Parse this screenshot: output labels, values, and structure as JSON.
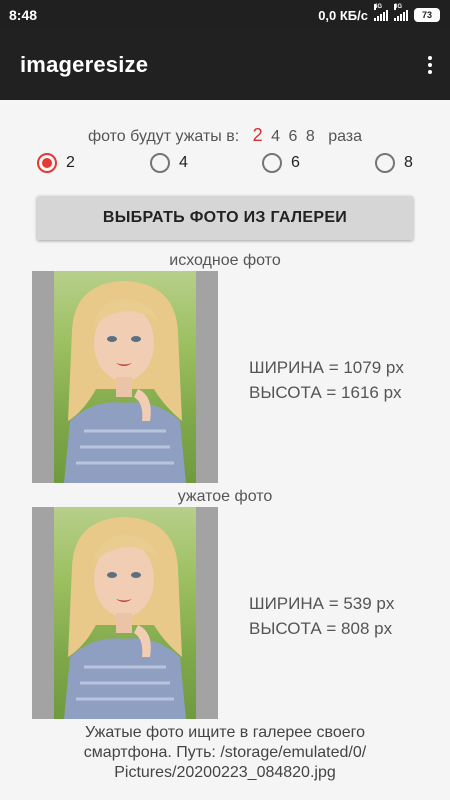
{
  "status": {
    "time": "8:48",
    "speed": "0,0 КБ/с",
    "net1": "4G",
    "net2": "3G",
    "battery": "73"
  },
  "app": {
    "title": "imageresize"
  },
  "ratio": {
    "label": "фото будут ужаты в:",
    "options": [
      "2",
      "4",
      "6",
      "8"
    ],
    "suffix": "раза",
    "active": "2"
  },
  "radios": [
    {
      "label": "2",
      "checked": true
    },
    {
      "label": "4",
      "checked": false
    },
    {
      "label": "6",
      "checked": false
    },
    {
      "label": "8",
      "checked": false
    }
  ],
  "button": {
    "label": "ВЫБРАТЬ ФОТО ИЗ ГАЛЕРЕИ"
  },
  "original": {
    "caption": "исходное фото",
    "width": "ШИРИНА = 1079 px",
    "height": "ВЫСОТА = 1616 px"
  },
  "compressed": {
    "caption": "ужатое фото",
    "width": "ШИРИНА = 539 px",
    "height": "ВЫСОТА = 808 px"
  },
  "footer": {
    "line1": "Ужатые фото ищите в галерее своего",
    "line2": "смартфона.  Путь: /storage/emulated/0/",
    "line3": "Pictures/20200223_084820.jpg"
  },
  "colors": {
    "accent": "#e53935",
    "appbar": "#212121",
    "statusbar": "#202020",
    "background": "#f5f5f5"
  }
}
